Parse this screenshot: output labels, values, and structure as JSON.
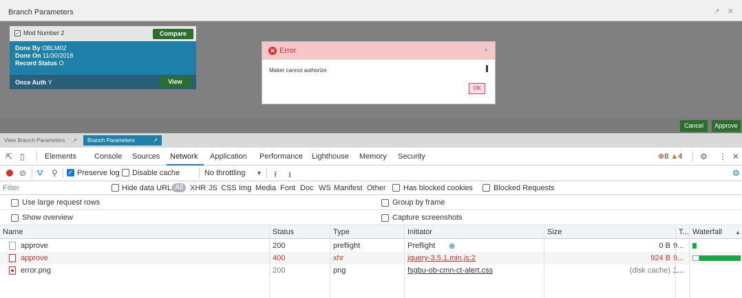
{
  "app": {
    "title": "Branch Parameters",
    "window_controls": "↗ ✕",
    "card": {
      "mod_label": "Mod Number 2",
      "compare": "Compare",
      "done_by_label": "Done By",
      "done_by_value": "OBLM02",
      "done_on_label": "Done On",
      "done_on_value": "11/30/2018",
      "record_status_label": "Record Status",
      "record_status_value": "O",
      "once_auth_label": "Once Auth",
      "once_auth_value": "Y",
      "view": "View"
    },
    "modal": {
      "title": "Error",
      "message": "Maker cannot authorize",
      "ok": "OK",
      "close": "×"
    },
    "cancel": "Cancel",
    "approve": "Approve",
    "taskbar": {
      "view_branch": "View Branch Parameters",
      "branch": "Branch Parameters",
      "expand": "↗"
    }
  },
  "devtools": {
    "tabs": [
      "Elements",
      "Console",
      "Sources",
      "Network",
      "Application",
      "Performance",
      "Lighthouse",
      "Memory",
      "Security"
    ],
    "active_tab": "Network",
    "issues": {
      "errors": "8",
      "warnings": "4"
    },
    "toolbar": {
      "preserve_log": "Preserve log",
      "disable_cache": "Disable cache",
      "throttling": "No throttling"
    },
    "filter": {
      "placeholder": "Filter",
      "hide_data_urls": "Hide data URLs",
      "types": [
        "All",
        "XHR",
        "JS",
        "CSS",
        "Img",
        "Media",
        "Font",
        "Doc",
        "WS",
        "Manifest",
        "Other"
      ],
      "has_blocked_cookies": "Has blocked cookies",
      "blocked_requests": "Blocked Requests"
    },
    "options": {
      "large_rows": "Use large request rows",
      "group_by_frame": "Group by frame",
      "show_overview": "Show overview",
      "capture_screenshots": "Capture screenshots"
    },
    "table": {
      "headers": [
        "Name",
        "Status",
        "Type",
        "Initiator",
        "Size",
        "T...",
        "Waterfall"
      ],
      "rows": [
        {
          "name": "approve",
          "status": "200",
          "type": "preflight",
          "initiator": "Preflight",
          "size": "0 B",
          "time": "9...",
          "error": false
        },
        {
          "name": "approve",
          "status": "400",
          "type": "xhr",
          "initiator": "jquery-3.5.1.min.js:2",
          "size": "924 B",
          "time": "9...",
          "error": true
        },
        {
          "name": "error.png",
          "status": "200",
          "type": "png",
          "initiator": "fsgbu-ob-cmn-ct-alert.css",
          "size": "(disk cache)",
          "time": "1...",
          "error": false
        }
      ]
    }
  }
}
